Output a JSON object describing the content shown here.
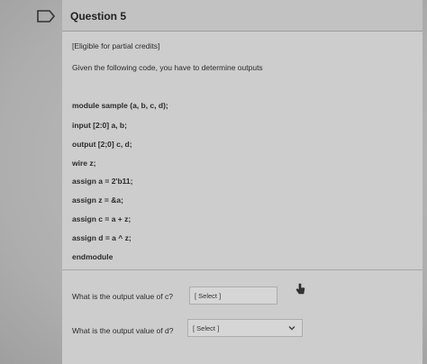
{
  "question": {
    "title": "Question 5",
    "eligibility": "[Eligible for partial credits]",
    "instruction": "Given the following code, you have to determine outputs"
  },
  "code_lines": [
    "module sample (a, b, c, d);",
    "input [2:0] a, b;",
    "output [2;0] c, d;",
    "wire z;",
    "assign a = 2'b11;",
    "assign z = &a;",
    "assign c = a + z;",
    "assign d = a ^ z;",
    "endmodule"
  ],
  "answers": [
    {
      "prompt": "What is the output value of c?",
      "select_value": "[ Select ]"
    },
    {
      "prompt": "What is the output value of d?",
      "select_value": "[ Select ]"
    }
  ],
  "icons": {
    "flag": "flag-outline-icon",
    "dropdown": "chevron-down-icon",
    "cursor": "hand-cursor-icon"
  }
}
